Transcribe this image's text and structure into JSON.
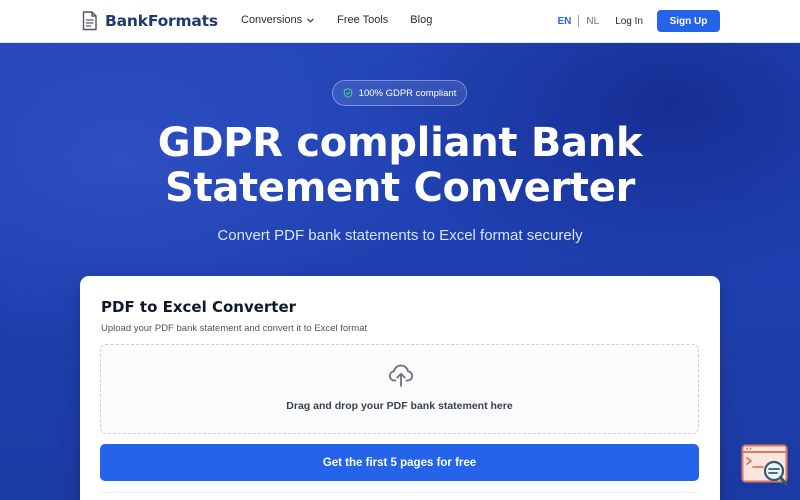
{
  "nav": {
    "brand": "BankFormats",
    "links": [
      {
        "label": "Conversions",
        "dropdown": true
      },
      {
        "label": "Free Tools"
      },
      {
        "label": "Blog"
      }
    ],
    "languages": [
      "EN",
      "NL"
    ],
    "active_language": "EN",
    "login_label": "Log In",
    "signup_label": "Sign Up"
  },
  "hero": {
    "badge": "100% GDPR compliant",
    "title_line1": "GDPR compliant Bank",
    "title_line2": "Statement Converter",
    "subtitle": "Convert PDF bank statements to Excel format securely"
  },
  "converter": {
    "title": "PDF to Excel Converter",
    "description": "Upload your PDF bank statement and convert it to Excel format",
    "dropzone_text": "Drag and drop your PDF bank statement here",
    "cta_label": "Get the first 5 pages for free"
  },
  "icons": {
    "logo": "document-icon",
    "badge": "shield-check-icon",
    "dropzone": "cloud-upload-icon",
    "widget": "terminal-search-icon",
    "nav_dropdown": "chevron-down-icon"
  },
  "colors": {
    "accent": "#2563eb",
    "brand_text": "#1e3a6e",
    "hero_bg": "#1e3fae",
    "widget": "#e0795f"
  }
}
